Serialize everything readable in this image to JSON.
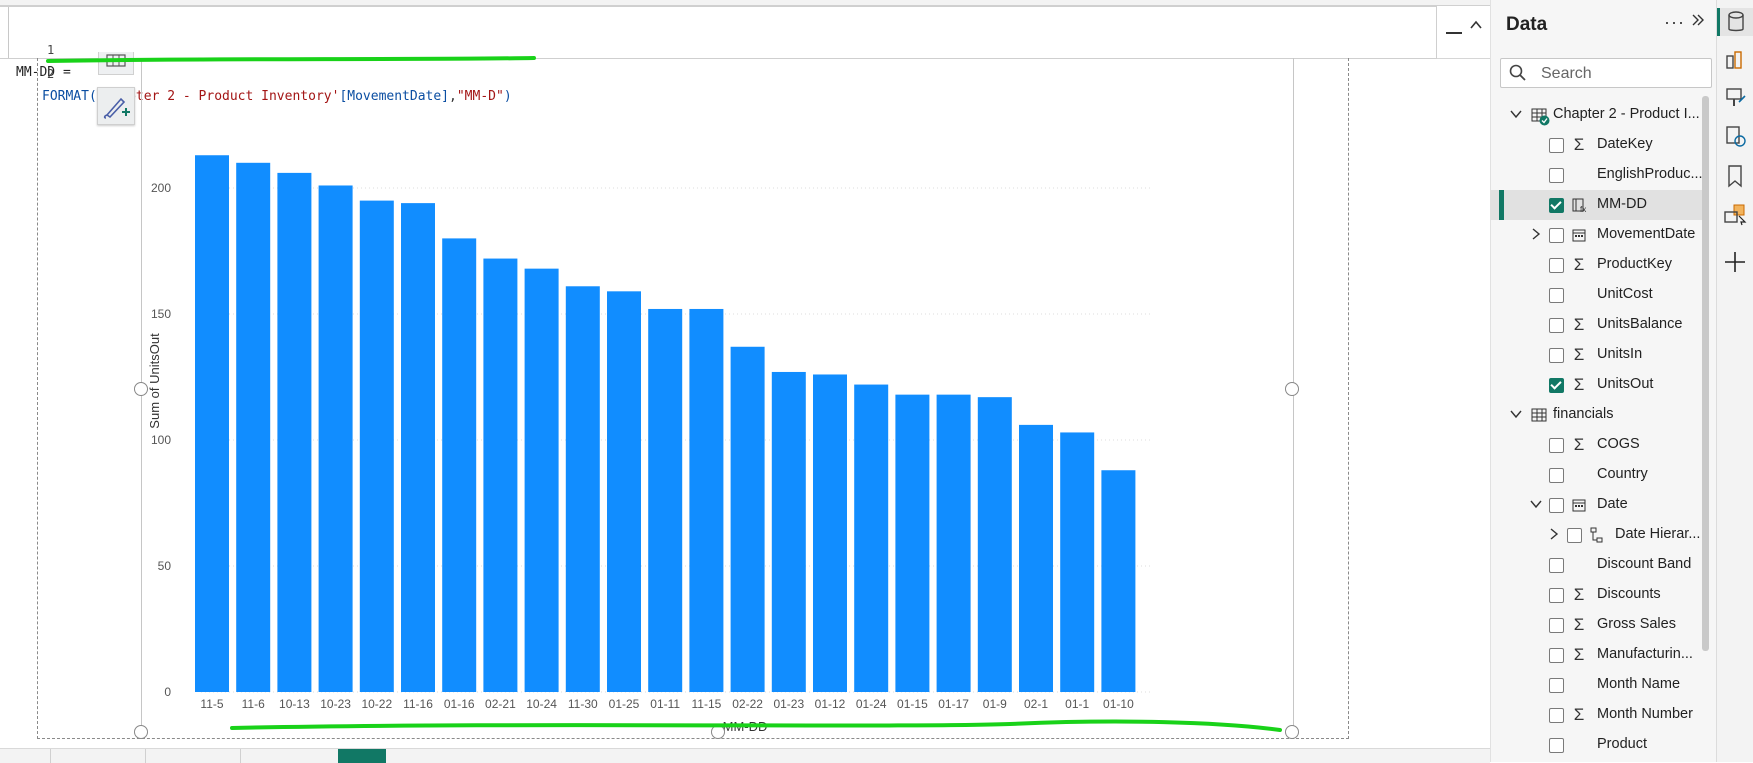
{
  "formula": {
    "line1_no": "1",
    "line1": "MM-DD =",
    "line2_no": "2",
    "line2_func": "FORMAT(",
    "line2_table": "'Chapter 2 - Product Inventory'",
    "line2_column": "[MovementDate]",
    "line2_sep": ",",
    "line2_format": "\"MM-D\"",
    "line2_close": ")"
  },
  "data_pane": {
    "title": "Data",
    "more_icon": "ellipsis-icon",
    "hide_icon": "double-chevron-right-icon",
    "search_placeholder": "Search",
    "tables": [
      {
        "name": "Chapter 2 - Product I...",
        "expanded": true,
        "fields": [
          {
            "label": "DateKey",
            "icon": "sigma",
            "checked": false
          },
          {
            "label": "EnglishProduc...",
            "icon": "",
            "checked": false
          },
          {
            "label": "MM-DD",
            "icon": "calculated-column",
            "checked": true,
            "selected": true
          },
          {
            "label": "MovementDate",
            "icon": "calendar",
            "checked": false,
            "expandable": true
          },
          {
            "label": "ProductKey",
            "icon": "sigma",
            "checked": false
          },
          {
            "label": "UnitCost",
            "icon": "",
            "checked": false
          },
          {
            "label": "UnitsBalance",
            "icon": "sigma",
            "checked": false
          },
          {
            "label": "UnitsIn",
            "icon": "sigma",
            "checked": false
          },
          {
            "label": "UnitsOut",
            "icon": "sigma",
            "checked": true
          }
        ]
      },
      {
        "name": "financials",
        "expanded": true,
        "fields": [
          {
            "label": "COGS",
            "icon": "sigma",
            "checked": false
          },
          {
            "label": "Country",
            "icon": "",
            "checked": false
          },
          {
            "label": "Date",
            "icon": "calendar",
            "checked": false,
            "expandable": true,
            "expanded": true
          },
          {
            "label": "Date Hierar...",
            "icon": "hierarchy",
            "checked": false,
            "expandable": true,
            "nested": true
          },
          {
            "label": "Discount Band",
            "icon": "",
            "checked": false
          },
          {
            "label": "Discounts",
            "icon": "sigma",
            "checked": false
          },
          {
            "label": "Gross Sales",
            "icon": "sigma",
            "checked": false
          },
          {
            "label": "Manufacturin...",
            "icon": "sigma",
            "checked": false
          },
          {
            "label": "Month Name",
            "icon": "",
            "checked": false
          },
          {
            "label": "Month Number",
            "icon": "sigma",
            "checked": false
          },
          {
            "label": "Product",
            "icon": "",
            "checked": false
          }
        ]
      }
    ]
  },
  "side_strip": [
    "data-icon",
    "build-visual-icon",
    "format-brush-icon",
    "performance-icon",
    "bookmark-icon",
    "selection-icon",
    "add-icon"
  ],
  "colors": {
    "bar": "#118DFF",
    "accent": "#117865",
    "annotation": "#19d219"
  },
  "chart_data": {
    "type": "bar",
    "xlabel": "MM-DD",
    "ylabel": "Sum of UnitsOut",
    "ylim": [
      0,
      215
    ],
    "yticks": [
      0,
      50,
      100,
      150,
      200
    ],
    "categories": [
      "11-5",
      "11-6",
      "10-13",
      "10-23",
      "10-22",
      "11-16",
      "01-16",
      "02-21",
      "10-24",
      "11-30",
      "01-25",
      "01-11",
      "11-15",
      "02-22",
      "01-23",
      "01-12",
      "01-24",
      "01-15",
      "01-17",
      "01-9",
      "02-1",
      "01-1",
      "01-10"
    ],
    "values": [
      213,
      210,
      206,
      201,
      195,
      194,
      180,
      172,
      168,
      161,
      159,
      152,
      152,
      137,
      127,
      126,
      122,
      118,
      118,
      117,
      106,
      103,
      88
    ],
    "grid": true
  }
}
